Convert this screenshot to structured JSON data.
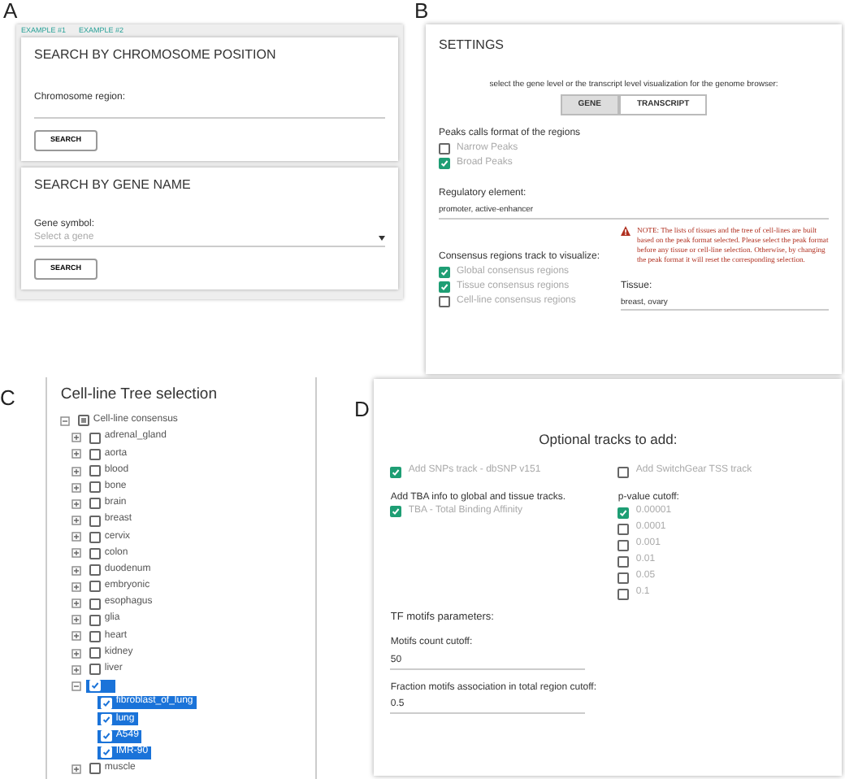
{
  "panel_a": {
    "label": "A",
    "example_links": [
      "EXAMPLE #1",
      "EXAMPLE #2"
    ],
    "chromosome_search": {
      "title": "SEARCH BY CHROMOSOME POSITION",
      "field_label": "Chromosome region:",
      "button": "SEARCH"
    },
    "gene_search": {
      "title": "SEARCH BY GENE NAME",
      "field_label": "Gene symbol:",
      "placeholder": "Select a gene",
      "button": "SEARCH"
    }
  },
  "panel_b": {
    "label": "B",
    "title": "SETTINGS",
    "prompt": "select the gene level or the transcript level visualization for the genome browser:",
    "level_toggle": [
      {
        "label": "GENE",
        "selected": true
      },
      {
        "label": "TRANSCRIPT",
        "selected": false
      }
    ],
    "peaks": {
      "label": "Peaks calls format of the regions",
      "options": [
        {
          "label": "Narrow Peaks",
          "checked": false
        },
        {
          "label": "Broad Peaks",
          "checked": true
        }
      ]
    },
    "regulatory": {
      "label": "Regulatory element:",
      "value": "promoter,  active-enhancer"
    },
    "consensus": {
      "label": "Consensus regions track to visualize:",
      "options": [
        {
          "label": "Global consensus regions",
          "checked": true
        },
        {
          "label": "Tissue consensus regions",
          "checked": true
        },
        {
          "label": "Cell-line consensus regions",
          "checked": false
        }
      ]
    },
    "note": "NOTE: The lists of tissues and the tree of cell-lines are built based on the peak format selected. Please select the peak format before any tissue or cell-line selection. Otherwise, by changing the peak format it will reset the corresponding selection.",
    "tissue": {
      "label": "Tissue:",
      "value": "breast,  ovary"
    }
  },
  "panel_c": {
    "label": "C",
    "title": "Cell-line Tree selection",
    "tree": [
      {
        "label": "Cell-line consensus",
        "indeterminate": true,
        "expanded": true,
        "selected": false,
        "children": [
          {
            "label": "adrenal_gland",
            "checked": false,
            "expanded": false,
            "selected": false
          },
          {
            "label": "aorta",
            "checked": false,
            "expanded": false,
            "selected": false
          },
          {
            "label": "blood",
            "checked": false,
            "expanded": false,
            "selected": false
          },
          {
            "label": "bone",
            "checked": false,
            "expanded": false,
            "selected": false
          },
          {
            "label": "brain",
            "checked": false,
            "expanded": false,
            "selected": false
          },
          {
            "label": "breast",
            "checked": false,
            "expanded": false,
            "selected": false
          },
          {
            "label": "cervix",
            "checked": false,
            "expanded": false,
            "selected": false
          },
          {
            "label": "colon",
            "checked": false,
            "expanded": false,
            "selected": false
          },
          {
            "label": "duodenum",
            "checked": false,
            "expanded": false,
            "selected": false
          },
          {
            "label": "embryonic",
            "checked": false,
            "expanded": false,
            "selected": false
          },
          {
            "label": "esophagus",
            "checked": false,
            "expanded": false,
            "selected": false
          },
          {
            "label": "glia",
            "checked": false,
            "expanded": false,
            "selected": false
          },
          {
            "label": "heart",
            "checked": false,
            "expanded": false,
            "selected": false
          },
          {
            "label": "kidney",
            "checked": false,
            "expanded": false,
            "selected": false
          },
          {
            "label": "liver",
            "checked": false,
            "expanded": false,
            "selected": false
          },
          {
            "checked": true,
            "expanded": true,
            "selected": true,
            "children": [
              {
                "label": "fibroblast_of_lung",
                "checked": true,
                "selected": true
              },
              {
                "label": "lung",
                "checked": true,
                "selected": true
              },
              {
                "label": "A549",
                "checked": true,
                "selected": true
              },
              {
                "label": "IMR-90",
                "checked": true,
                "selected": true
              }
            ]
          },
          {
            "label": "muscle",
            "checked": false,
            "expanded": false,
            "selected": false
          }
        ]
      }
    ]
  },
  "panel_d": {
    "label": "D",
    "title": "Optional tracks to add:",
    "snp_track": {
      "label": "Add SNPs track - dbSNP v151",
      "checked": true
    },
    "switchgear_track": {
      "label": "Add SwitchGear TSS track",
      "checked": false
    },
    "tba": {
      "heading": "Add TBA info to global and tissue tracks.",
      "option": {
        "label": "TBA - Total Binding Affinity",
        "checked": true
      }
    },
    "pvalue": {
      "label": "p-value cutoff:",
      "options": [
        {
          "label": "0.00001",
          "checked": true
        },
        {
          "label": "0.0001",
          "checked": false
        },
        {
          "label": "0.001",
          "checked": false
        },
        {
          "label": "0.01",
          "checked": false
        },
        {
          "label": "0.05",
          "checked": false
        },
        {
          "label": "0.1",
          "checked": false
        }
      ]
    },
    "tf_motifs": {
      "heading": "TF motifs parameters:",
      "fields": [
        {
          "label": "Motifs count cutoff:",
          "value": "50"
        },
        {
          "label": "Fraction motifs association in total region cutoff:",
          "value": "0.5"
        }
      ]
    }
  }
}
